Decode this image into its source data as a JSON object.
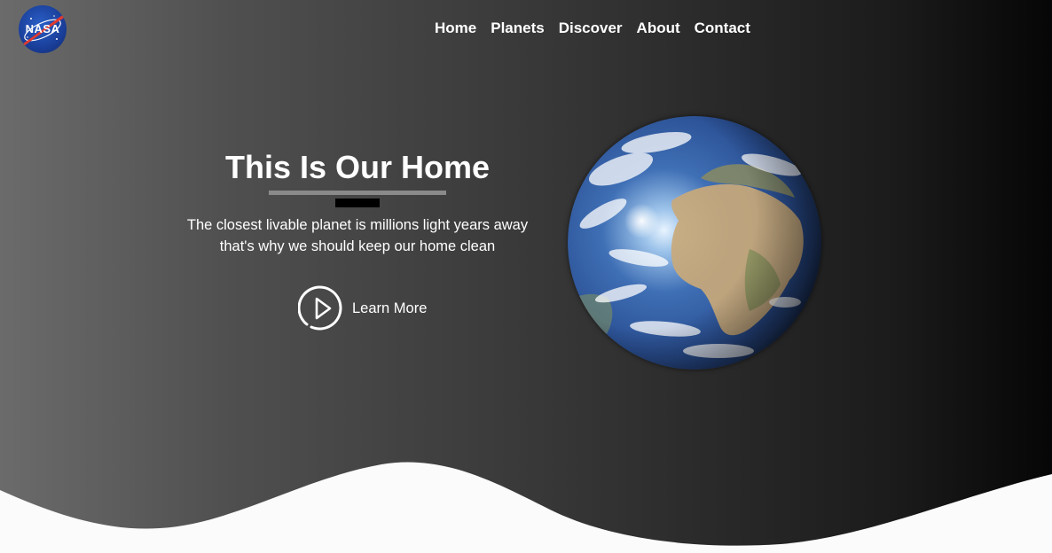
{
  "logo": {
    "text": "NASA",
    "icon": "nasa-meatball-logo"
  },
  "nav": {
    "items": [
      {
        "label": "Home"
      },
      {
        "label": "Planets"
      },
      {
        "label": "Discover"
      },
      {
        "label": "About"
      },
      {
        "label": "Contact"
      }
    ]
  },
  "hero": {
    "title": "This Is Our Home",
    "description": "The closest livable planet is millions light years away that's why we should keep our home clean",
    "cta_label": "Learn More",
    "cta_icon": "play-circle-icon",
    "image": "earth-globe-image"
  },
  "colors": {
    "background_left": "#6b6b6b",
    "background_right": "#060606",
    "text": "#ffffff",
    "underline_grey": "#8a8a8a",
    "underline_black": "#000000",
    "wave": "#fbfbfb"
  }
}
